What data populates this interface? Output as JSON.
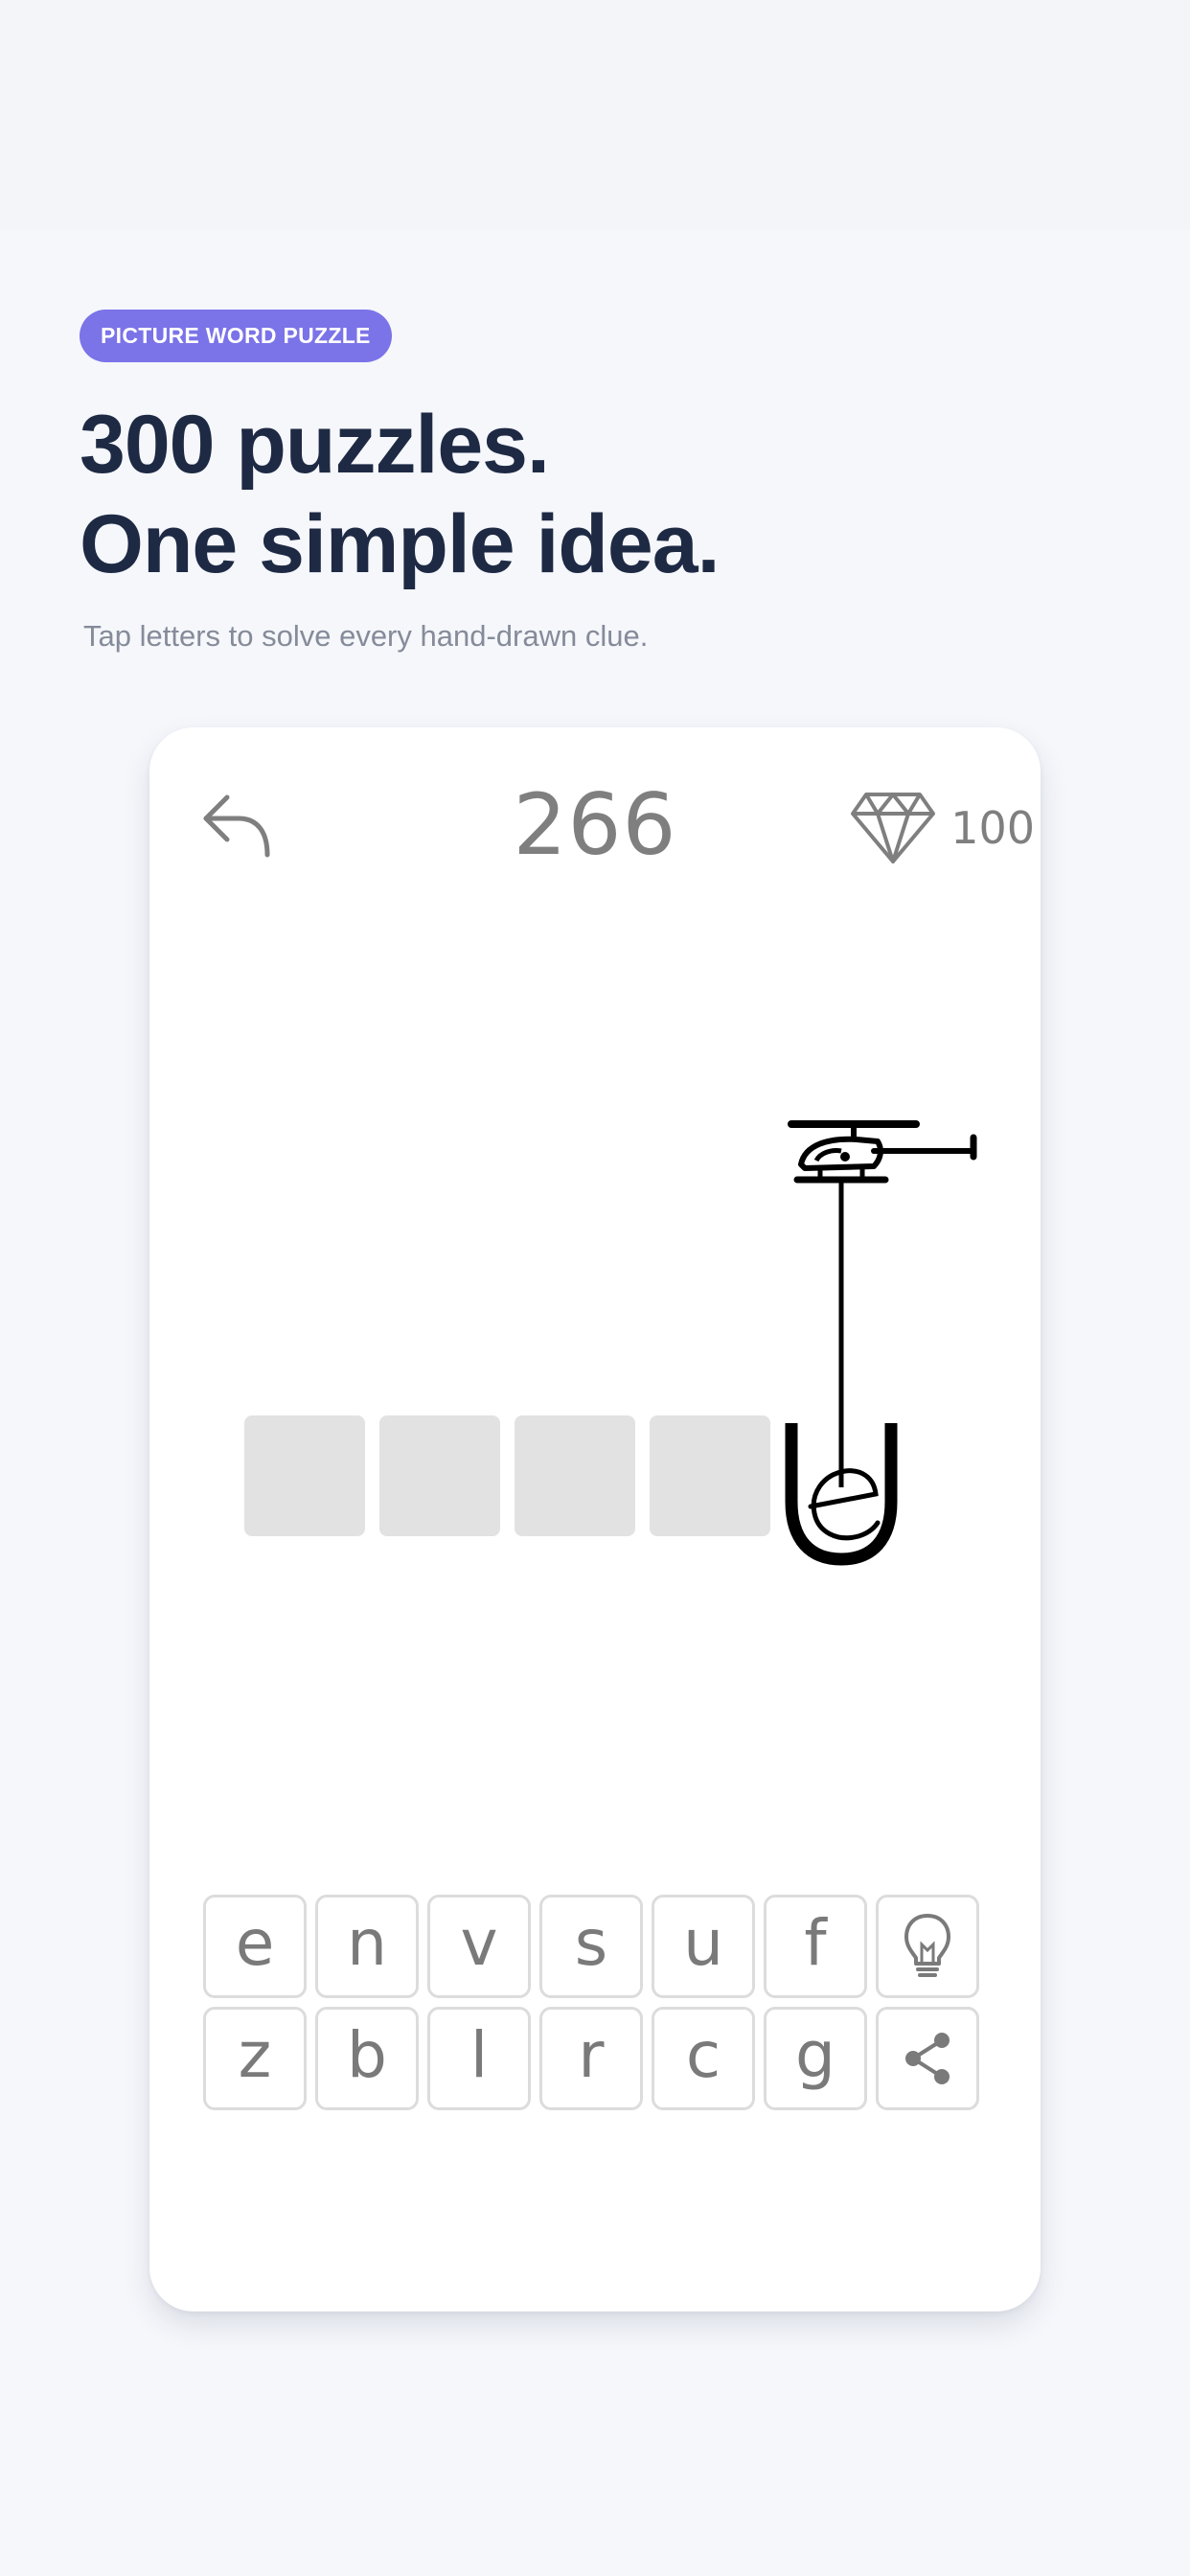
{
  "header": {
    "badge": "PICTURE WORD PUZZLE",
    "headline_line1": "300 puzzles.",
    "headline_line2": "One simple idea.",
    "subhead": "Tap letters to solve every hand-drawn clue."
  },
  "game": {
    "level": "266",
    "gems": "100",
    "answer_length_blank": 4,
    "clue_picture": "helicopter-over-letter-e-in-u-icon",
    "keyboard": {
      "row1": [
        "e",
        "n",
        "v",
        "s",
        "u",
        "f"
      ],
      "row2": [
        "z",
        "b",
        "l",
        "r",
        "c",
        "g"
      ],
      "hint_icon": "lightbulb-icon",
      "share_icon": "share-icon"
    }
  },
  "colors": {
    "accent": "#7b73e8",
    "headline": "#1e2a44",
    "subhead": "#858b99",
    "slot": "#e2e2e2",
    "key_text": "#7a7a7a"
  }
}
